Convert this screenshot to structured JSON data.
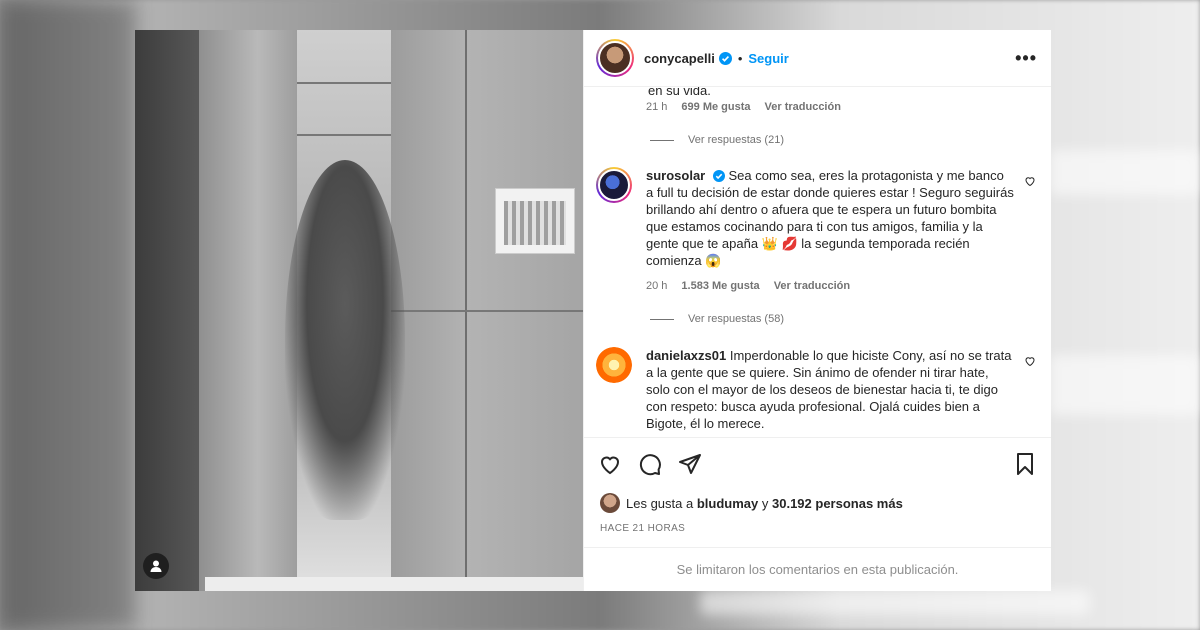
{
  "post": {
    "username": "conycapelli",
    "follow_label": "Seguir",
    "separator": "•",
    "more_label": "•••"
  },
  "comments": {
    "prev_fragment": "en su vida.",
    "prev_meta": {
      "time": "21 h",
      "likes": "699 Me gusta",
      "translate": "Ver traducción"
    },
    "prev_replies": "Ver respuestas (21)",
    "items": [
      {
        "username": "surosolar",
        "verified": true,
        "text": "Sea como sea, eres la protagonista y me banco a full tu decisión de estar donde quieres estar ! Seguro seguirás brillando ahí dentro o afuera que te espera un futuro bombita que estamos cocinando para ti con tus amigos, familia y la gente que te apaña 👑 💋 la segunda temporada recién comienza 😱",
        "time": "20 h",
        "likes": "1.583 Me gusta",
        "translate": "Ver traducción",
        "replies": "Ver respuestas (58)"
      },
      {
        "username": "danielaxzs01",
        "verified": false,
        "text": "Imperdonable lo que hiciste Cony, así no se trata a la gente que se quiere. Sin ánimo de ofender ni tirar hate, solo con el mayor de los deseos de bienestar hacia ti, te digo con respeto: busca ayuda profesional. Ojalá cuides bien a Bigote, él lo merece."
      }
    ]
  },
  "likes": {
    "prefix": "Les gusta a",
    "user": "bludumay",
    "joiner": "y",
    "count": "30.192 personas más"
  },
  "time_ago": "HACE 21 HORAS",
  "limited_comments": "Se limitaron los comentarios en esta publicación.",
  "colors": {
    "accent": "#0095f6",
    "muted": "#737373",
    "text": "#262626"
  },
  "icons": [
    "verified-icon",
    "more-icon",
    "heart-icon",
    "comment-icon",
    "share-icon",
    "bookmark-icon",
    "user-tag-icon"
  ]
}
